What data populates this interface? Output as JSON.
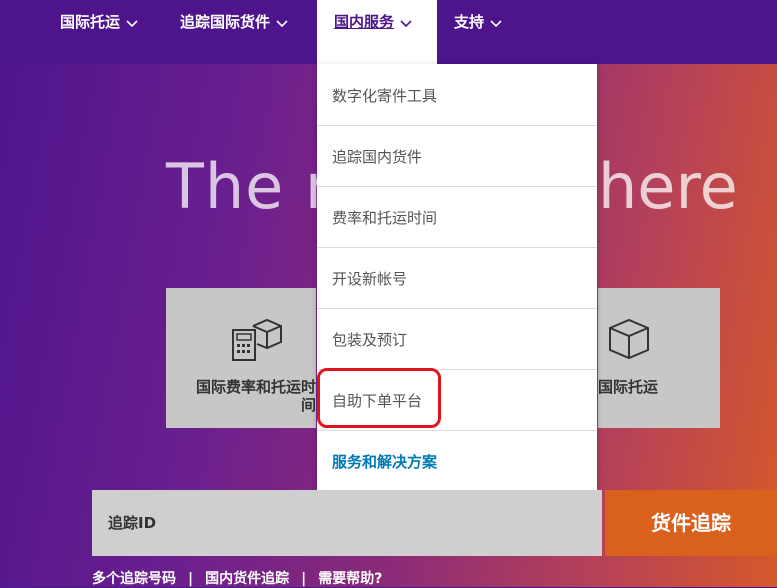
{
  "nav": {
    "items": [
      {
        "label": "国际托运"
      },
      {
        "label": "追踪国际货件"
      },
      {
        "label": "国内服务"
      },
      {
        "label": "支持"
      }
    ]
  },
  "hero": {
    "title_left": "The n",
    "title_right": "here"
  },
  "tiles": {
    "rates": "国际费率和托运时间",
    "ship": "国际托运"
  },
  "dropdown": {
    "items": [
      {
        "label": "数字化寄件工具"
      },
      {
        "label": "追踪国内货件"
      },
      {
        "label": "费率和托运时间"
      },
      {
        "label": "开设新帐号"
      },
      {
        "label": "包装及预订"
      },
      {
        "label": "自助下单平台"
      },
      {
        "label": "服务和解决方案"
      }
    ]
  },
  "tracking": {
    "placeholder": "追踪ID",
    "button": "货件追踪"
  },
  "bottom_links": {
    "multi": "多个追踪号码",
    "domestic": "国内货件追踪",
    "help": "需要帮助?"
  },
  "colors": {
    "brand_purple": "#4d148c",
    "brand_orange": "#d9611c",
    "link_blue": "#007ab7",
    "highlight_red": "#e0141e"
  }
}
